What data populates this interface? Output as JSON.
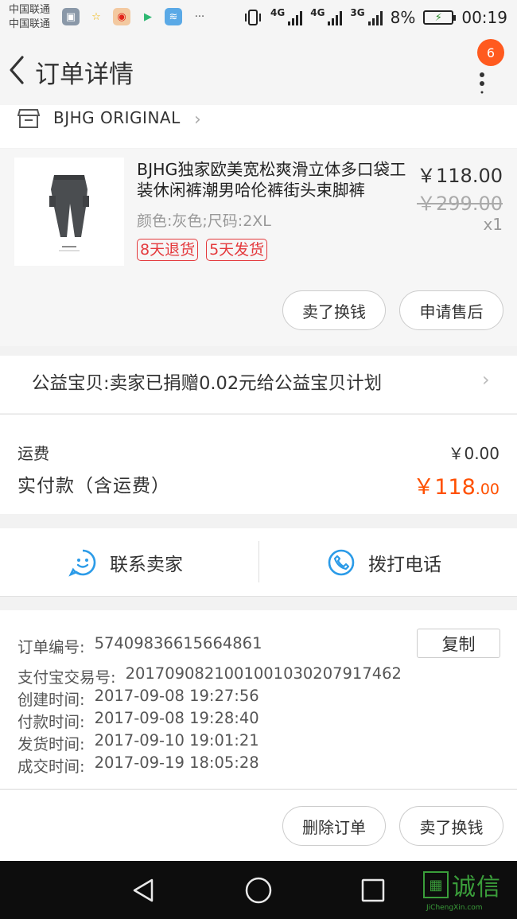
{
  "status_bar": {
    "carrier_1": "中国联通",
    "carrier_2": "中国联通",
    "net_1": "4G",
    "net_2": "4G",
    "net_3": "3G",
    "battery": "8%",
    "time": "00:19"
  },
  "nav": {
    "title": "订单详情",
    "badge_count": "6"
  },
  "shop": {
    "name": "BJHG ORIGINAL"
  },
  "product": {
    "title": "BJHG独家欧美宽松爽滑立体多口袋工装休闲裤潮男哈伦裤街头束脚裤",
    "sku": "颜色:灰色;尺码:2XL",
    "price": "￥118.00",
    "original_price": "￥299.00",
    "quantity": "x1",
    "tags": [
      "8天退货",
      "5天发货"
    ],
    "btn_sell": "卖了换钱",
    "btn_after_sale": "申请售后"
  },
  "charity": {
    "text": "公益宝贝:卖家已捐赠0.02元给公益宝贝计划"
  },
  "fees": {
    "shipping_label": "运费",
    "shipping_value": "￥0.00",
    "paid_label": "实付款（含运费）",
    "paid_int": "￥118",
    "paid_dec": ".00"
  },
  "contact": {
    "seller": "联系卖家",
    "phone": "拨打电话"
  },
  "order_info": {
    "copy_label": "复制",
    "rows": [
      {
        "key": "订单编号:",
        "value": "57409836615664861"
      },
      {
        "key": "支付宝交易号:",
        "value": "2017090821001001030207917462"
      },
      {
        "key": "创建时间:",
        "value": "2017-09-08 19:27:56"
      },
      {
        "key": "付款时间:",
        "value": "2017-09-08 19:28:40"
      },
      {
        "key": "发货时间:",
        "value": "2017-09-10 19:01:21"
      },
      {
        "key": "成交时间:",
        "value": "2017-09-19 18:05:28"
      }
    ]
  },
  "actions": {
    "delete": "删除订单",
    "sell": "卖了换钱"
  },
  "watermark": {
    "name": "诚信",
    "url": "JiChengXin.com"
  },
  "colors": {
    "accent": "#ff5000",
    "tag_red": "#e4393c",
    "contact_blue": "#2b9be8"
  }
}
